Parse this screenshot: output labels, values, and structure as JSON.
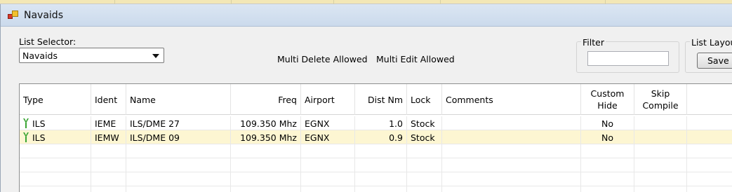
{
  "window": {
    "title": "Navaids"
  },
  "list_selector": {
    "label": "List Selector:",
    "value": "Navaids"
  },
  "status": {
    "multi_delete": "Multi Delete Allowed",
    "multi_edit": "Multi Edit Allowed"
  },
  "filter": {
    "title": "Filter",
    "value": ""
  },
  "list_layout": {
    "title": "List Layout",
    "save_label": "Save"
  },
  "grid": {
    "headers": {
      "type": "Type",
      "ident": "Ident",
      "name": "Name",
      "freq": "Freq",
      "airport": "Airport",
      "dist": "Dist Nm",
      "lock": "Lock",
      "comments": "Comments",
      "custom_hide_1": "Custom",
      "custom_hide_2": "Hide",
      "skip_compile_1": "Skip",
      "skip_compile_2": "Compile"
    },
    "rows": [
      {
        "icon": "ils-antenna-icon",
        "type": "ILS",
        "ident": "IEME",
        "name": "ILS/DME 27",
        "freq": "109.350 Mhz",
        "airport": "EGNX",
        "dist": "1.0",
        "lock": "Stock",
        "comments": "",
        "custom_hide": "No",
        "skip_compile": ""
      },
      {
        "icon": "ils-antenna-icon",
        "type": "ILS",
        "ident": "IEMW",
        "name": "ILS/DME 09",
        "freq": "109.350 Mhz",
        "airport": "EGNX",
        "dist": "0.9",
        "lock": "Stock",
        "comments": "",
        "custom_hide": "No",
        "skip_compile": ""
      }
    ]
  },
  "colors": {
    "selected_row": "#fdf6d2",
    "titlebar": "#cbdaec",
    "ils_icon": "#3aa534"
  }
}
